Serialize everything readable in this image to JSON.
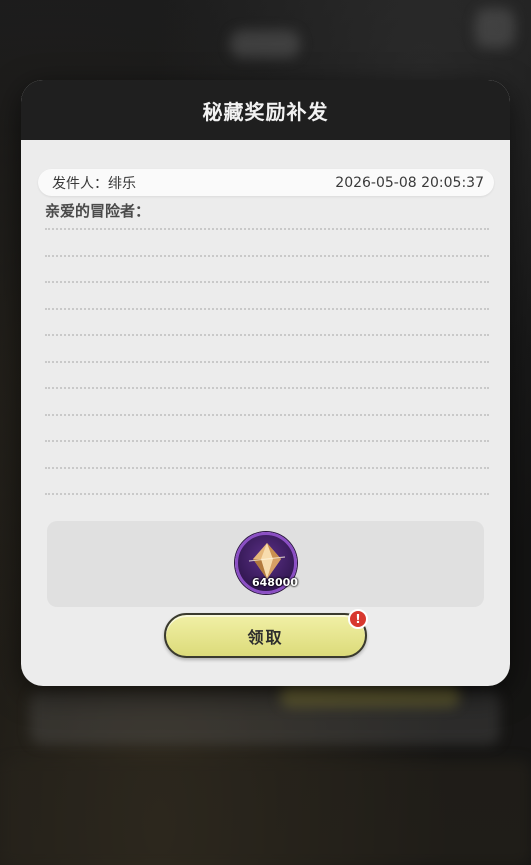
{
  "modal": {
    "title": "秘藏奖励补发"
  },
  "mail": {
    "sender_label": "发件人：",
    "sender_name": "绯乐",
    "timestamp": "2026-05-08 20:05:37",
    "greeting": "亲爱的冒险者："
  },
  "reward": {
    "icon": "crystal-gem-icon",
    "count": "648000",
    "frame_color": "#8b4fc4"
  },
  "actions": {
    "claim_label": "领取",
    "alert_badge": "!",
    "accent_color": "#dcdb7a"
  }
}
